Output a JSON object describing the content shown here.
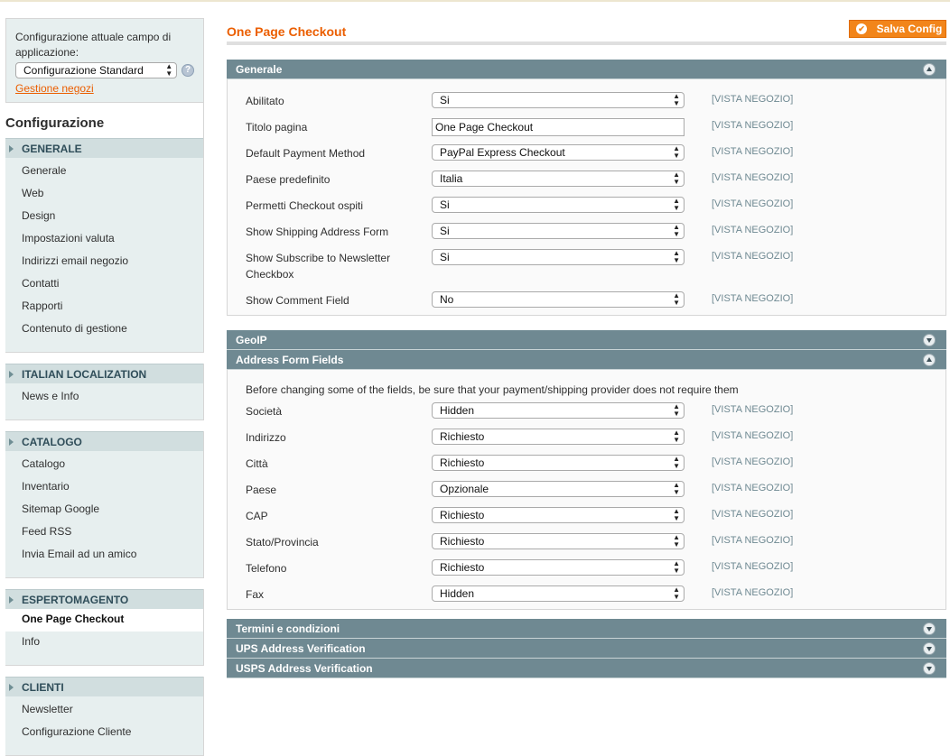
{
  "scope": {
    "label": "Configurazione attuale campo di applicazione:",
    "selected": "Configurazione Standard",
    "manage_link": "Gestione negozi"
  },
  "sidebar": {
    "title": "Configurazione",
    "groups": [
      {
        "heading": "GENERALE",
        "items": [
          "Generale",
          "Web",
          "Design",
          "Impostazioni valuta",
          "Indirizzi email negozio",
          "Contatti",
          "Rapporti",
          "Contenuto di gestione"
        ]
      },
      {
        "heading": "ITALIAN LOCALIZATION",
        "items": [
          "News e Info"
        ]
      },
      {
        "heading": "CATALOGO",
        "items": [
          "Catalogo",
          "Inventario",
          "Sitemap Google",
          "Feed RSS",
          "Invia Email ad un amico"
        ]
      },
      {
        "heading": "ESPERTOMAGENTO",
        "items": [
          "One Page Checkout",
          "Info"
        ]
      },
      {
        "heading": "CLIENTI",
        "items": [
          "Newsletter",
          "Configurazione Cliente"
        ]
      }
    ]
  },
  "page": {
    "title": "One Page Checkout",
    "save_label": "Salva Config"
  },
  "scope_tag": "[VISTA NEGOZIO]",
  "sections": {
    "generale": {
      "title": "Generale",
      "fields": [
        {
          "label": "Abilitato",
          "value": "Si"
        },
        {
          "label": "Titolo pagina",
          "value": "One Page Checkout"
        },
        {
          "label": "Default Payment Method",
          "value": "PayPal Express Checkout"
        },
        {
          "label": "Paese predefinito",
          "value": "Italia"
        },
        {
          "label": "Permetti Checkout ospiti",
          "value": "Si"
        },
        {
          "label": "Show Shipping Address Form",
          "value": "Si"
        },
        {
          "label": "Show Subscribe to Newsletter Checkbox",
          "value": "Si"
        },
        {
          "label": "Show Comment Field",
          "value": "No"
        }
      ]
    },
    "geoip": {
      "title": "GeoIP"
    },
    "address": {
      "title": "Address Form Fields",
      "note": "Before changing some of the fields, be sure that your payment/shipping provider does not require them",
      "fields": [
        {
          "label": "Società",
          "value": "Hidden"
        },
        {
          "label": "Indirizzo",
          "value": "Richiesto"
        },
        {
          "label": "Città",
          "value": "Richiesto"
        },
        {
          "label": "Paese",
          "value": "Opzionale"
        },
        {
          "label": "CAP",
          "value": "Richiesto"
        },
        {
          "label": "Stato/Provincia",
          "value": "Richiesto"
        },
        {
          "label": "Telefono",
          "value": "Richiesto"
        },
        {
          "label": "Fax",
          "value": "Hidden"
        }
      ]
    },
    "terms": {
      "title": "Termini e condizioni"
    },
    "ups": {
      "title": "UPS Address Verification"
    },
    "usps": {
      "title": "USPS Address Verification"
    }
  }
}
